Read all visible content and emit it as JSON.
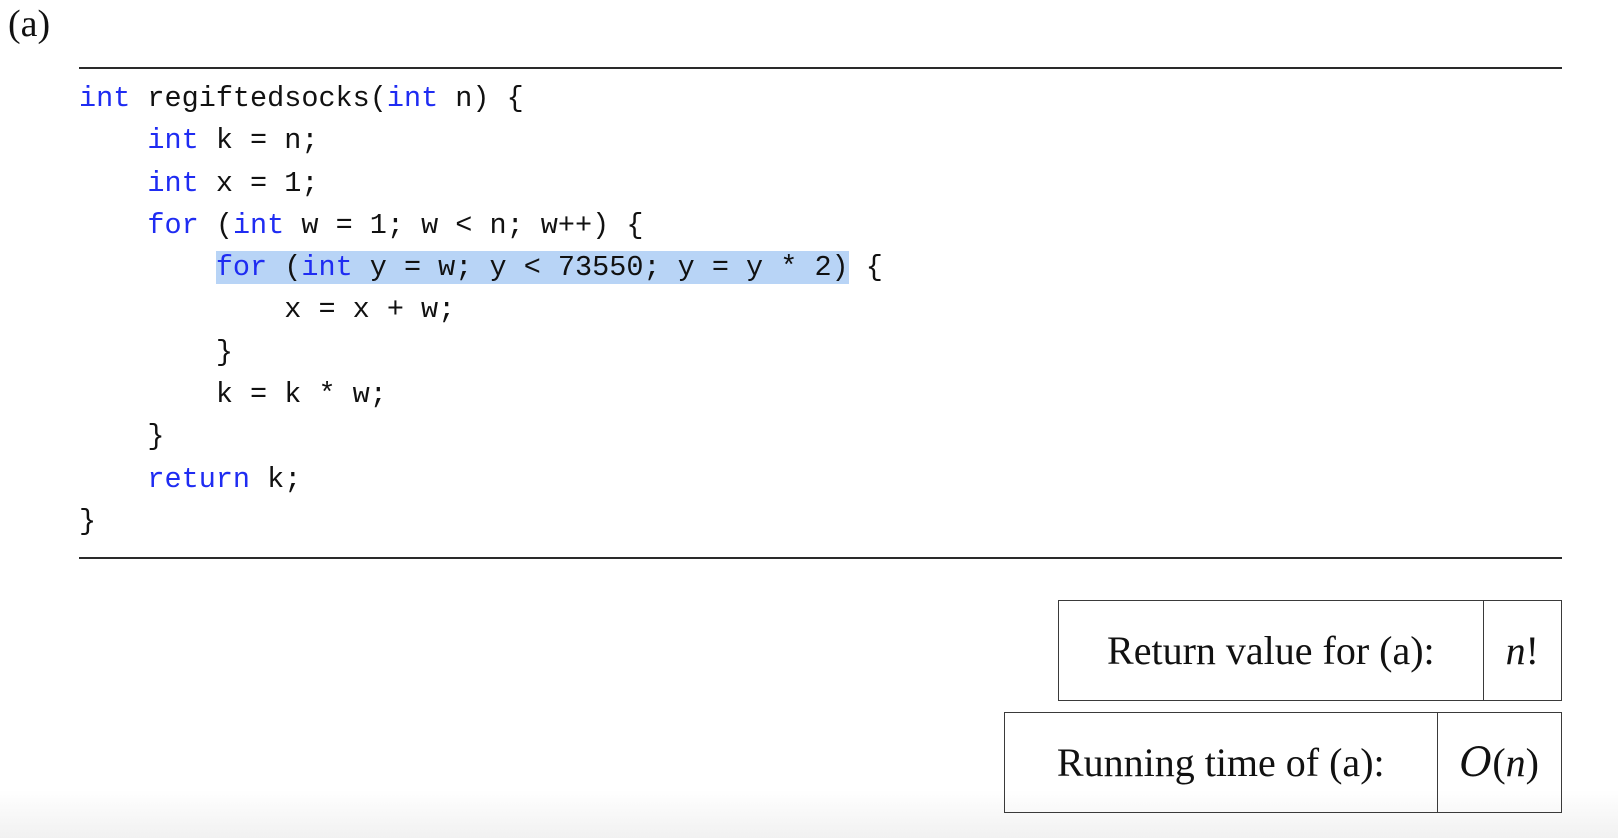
{
  "question_label": "(a)",
  "code": {
    "language": "c",
    "keyword_color": "#1f2cf2",
    "highlight_color": "#b8d4f6",
    "lines": [
      {
        "indent": "",
        "tokens": [
          {
            "t": "int",
            "kw": true
          },
          {
            "t": " regiftedsocks("
          },
          {
            "t": "int",
            "kw": true
          },
          {
            "t": " n) {"
          }
        ]
      },
      {
        "indent": "    ",
        "tokens": [
          {
            "t": "int",
            "kw": true
          },
          {
            "t": " k = n;"
          }
        ]
      },
      {
        "indent": "    ",
        "tokens": [
          {
            "t": "int",
            "kw": true
          },
          {
            "t": " x = 1;"
          }
        ]
      },
      {
        "indent": "    ",
        "tokens": [
          {
            "t": "for",
            "kw": true
          },
          {
            "t": " ("
          },
          {
            "t": "int",
            "kw": true
          },
          {
            "t": " w = 1; w < n; w++) {"
          }
        ]
      },
      {
        "indent": "        ",
        "tokens": [
          {
            "t": "for",
            "kw": true,
            "hl": true
          },
          {
            "t": " (",
            "hl": true
          },
          {
            "t": "int",
            "kw": true,
            "hl": true
          },
          {
            "t": " y = w; y < 73550; y = y * 2)",
            "hl": true
          },
          {
            "t": " {"
          }
        ]
      },
      {
        "indent": "            ",
        "tokens": [
          {
            "t": "x = x + w;"
          }
        ]
      },
      {
        "indent": "        ",
        "tokens": [
          {
            "t": "}"
          }
        ]
      },
      {
        "indent": "        ",
        "tokens": [
          {
            "t": "k = k * w;"
          }
        ]
      },
      {
        "indent": "    ",
        "tokens": [
          {
            "t": "}"
          }
        ]
      },
      {
        "indent": "    ",
        "tokens": [
          {
            "t": "return",
            "kw": true
          },
          {
            "t": " k;"
          }
        ]
      },
      {
        "indent": "",
        "tokens": [
          {
            "t": "}"
          }
        ]
      }
    ]
  },
  "answers": {
    "return_value": {
      "label": "Return value for (a):",
      "value_var": "n",
      "value_suffix": "!"
    },
    "running_time": {
      "label": "Running time of (a):",
      "value_prefix": "O",
      "value_open": "(",
      "value_var": "n",
      "value_close": ")"
    }
  }
}
